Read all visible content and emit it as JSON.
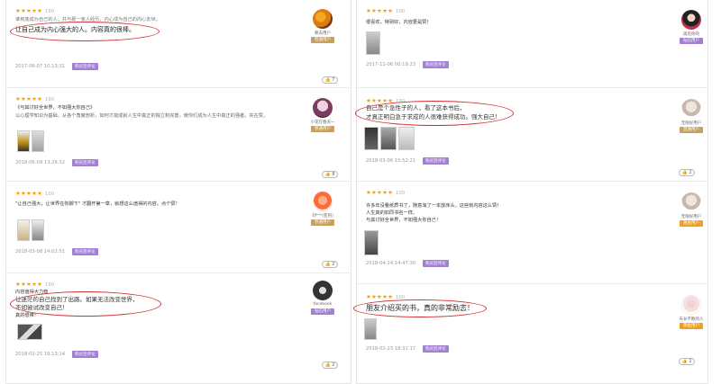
{
  "common": {
    "stars": "★★★★★",
    "score": "100",
    "tag": "购买后评论"
  },
  "colors": {
    "star": "#ff9d00",
    "tag": "#a27fd2",
    "member": "#a27fd2",
    "gold": "#f0a020",
    "annotation": "#d03030"
  },
  "left": [
    {
      "text_small": "谁到底成为自己的人，并与那一家人经历，内心成为自己的内心去世。",
      "text_big": "让自己成为内心强大的人。内容真的很棒。",
      "date": "2017-06-07 10:13:31",
      "likes": "7",
      "user": "要去用户",
      "badge": "普通用户"
    },
    {
      "text_line1": "《与其讨好全世界，不如强大你自己》",
      "text_line2": "以心理学知识为基础，从各个角度剖析，如何才能成就人生中真正的独立和完善，使你们成为人生中真正的强者。实在赞。",
      "date": "2018-06-09 13:26:32",
      "likes": "8",
      "user": "小花在春天一",
      "badge": "普通用户"
    },
    {
      "text_line1": "\"让自己强大，让世界在你脚下\" 才翻开第一章，就想这么值得的内容。点个赞！",
      "date": "2018-03-08 14:02:51",
      "likes": "2",
      "user": "刘***(亚利)",
      "badge": "普通用户"
    },
    {
      "text_line1": "内容值得大力荐",
      "text_big1": "让迷茫的自己找到了出路。如果无法改变世界，",
      "text_big2": "不如尝试改变自己！",
      "text_line3": "真的很棒！",
      "date": "2018-02-25 19:13:14",
      "likes": "2",
      "user": "facebook",
      "badge": "钻石用户"
    }
  ],
  "right": [
    {
      "text_line1": "很喜欢，特别好，内容更是赞！",
      "date": "2017-11-06 00:19:23",
      "likes": "",
      "user": "再见你的",
      "badge": "钻石用户"
    },
    {
      "text_big1": "自己是个急性子的人，看了这本书后，",
      "text_big2": "才真正明白急于求成的人很难获得成功。强大自己！",
      "date": "2018-03-06 15:52:21",
      "likes": "2",
      "user": "无限好用户",
      "badge": "普通用户"
    },
    {
      "text_line1": "许多年没看纸质书了，随意淘了一本放床头，这些刻内容这么赞！",
      "text_line2": "人生真的如同书名一样。",
      "text_line3": "与其讨好全世界，不如强大你自己！",
      "date": "2018-04-14 14:47:30",
      "likes": "",
      "user": "无限好用户",
      "badge": "黄金用户"
    },
    {
      "text_big1": "朋友介绍买的书，真的非常励志！",
      "date": "2018-02-23 18:31:17",
      "likes": "2",
      "user": "天长不散的人",
      "badge": "黄金用户"
    }
  ]
}
